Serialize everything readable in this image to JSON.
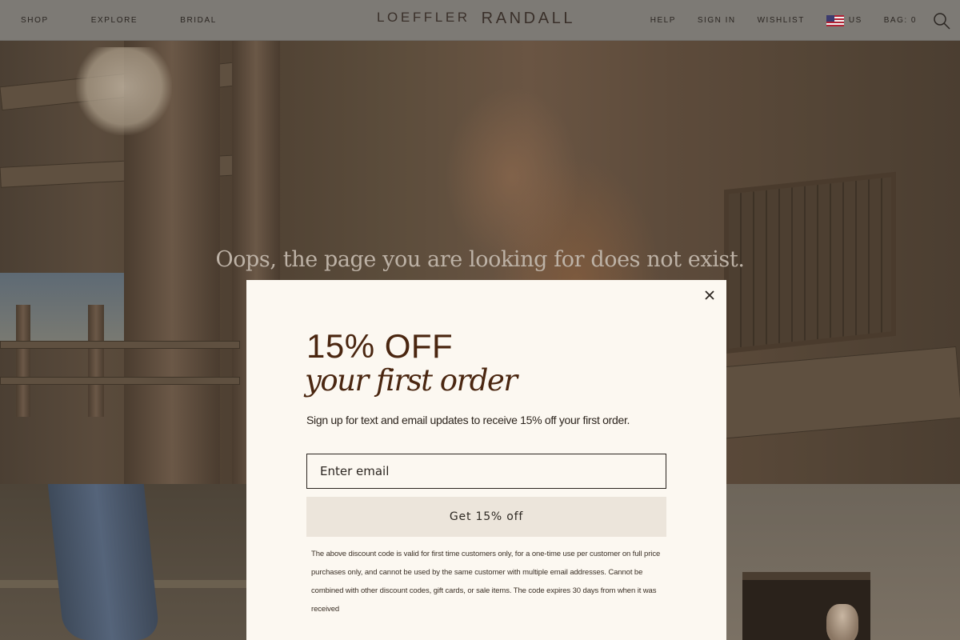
{
  "header": {
    "nav_left": [
      "SHOP",
      "EXPLORE",
      "BRIDAL"
    ],
    "logo_first": "LOEFFLER",
    "logo_second": "RANDALL",
    "help": "HELP",
    "sign_in": "SIGN IN",
    "wishlist": "WISHLIST",
    "region": "US",
    "bag": "BAG: 0",
    "icons": {
      "search": "search-icon",
      "flag": "us-flag-icon"
    }
  },
  "hero": {
    "message": "Oops, the page you are looking for does not exist."
  },
  "modal": {
    "headline": "15% OFF",
    "subheadline": "your first order",
    "lead": "Sign up for text and email updates to receive 15% off your first order.",
    "email_placeholder": "Enter email",
    "submit_label": "Get 15% off",
    "disclaimer": "The above discount code is valid for first time customers only, for a one-time use per customer on full price purchases only, and cannot be used by the same customer with multiple email addresses. Cannot be combined with other discount codes, gift cards, or sale items. The code expires 30 days from when it was received",
    "close_icon": "close-icon"
  },
  "colors": {
    "modal_bg": "#fcf8f1",
    "headline": "#4a2610",
    "button_bg": "#ece5db",
    "header_overlay": "#7d7a75"
  }
}
